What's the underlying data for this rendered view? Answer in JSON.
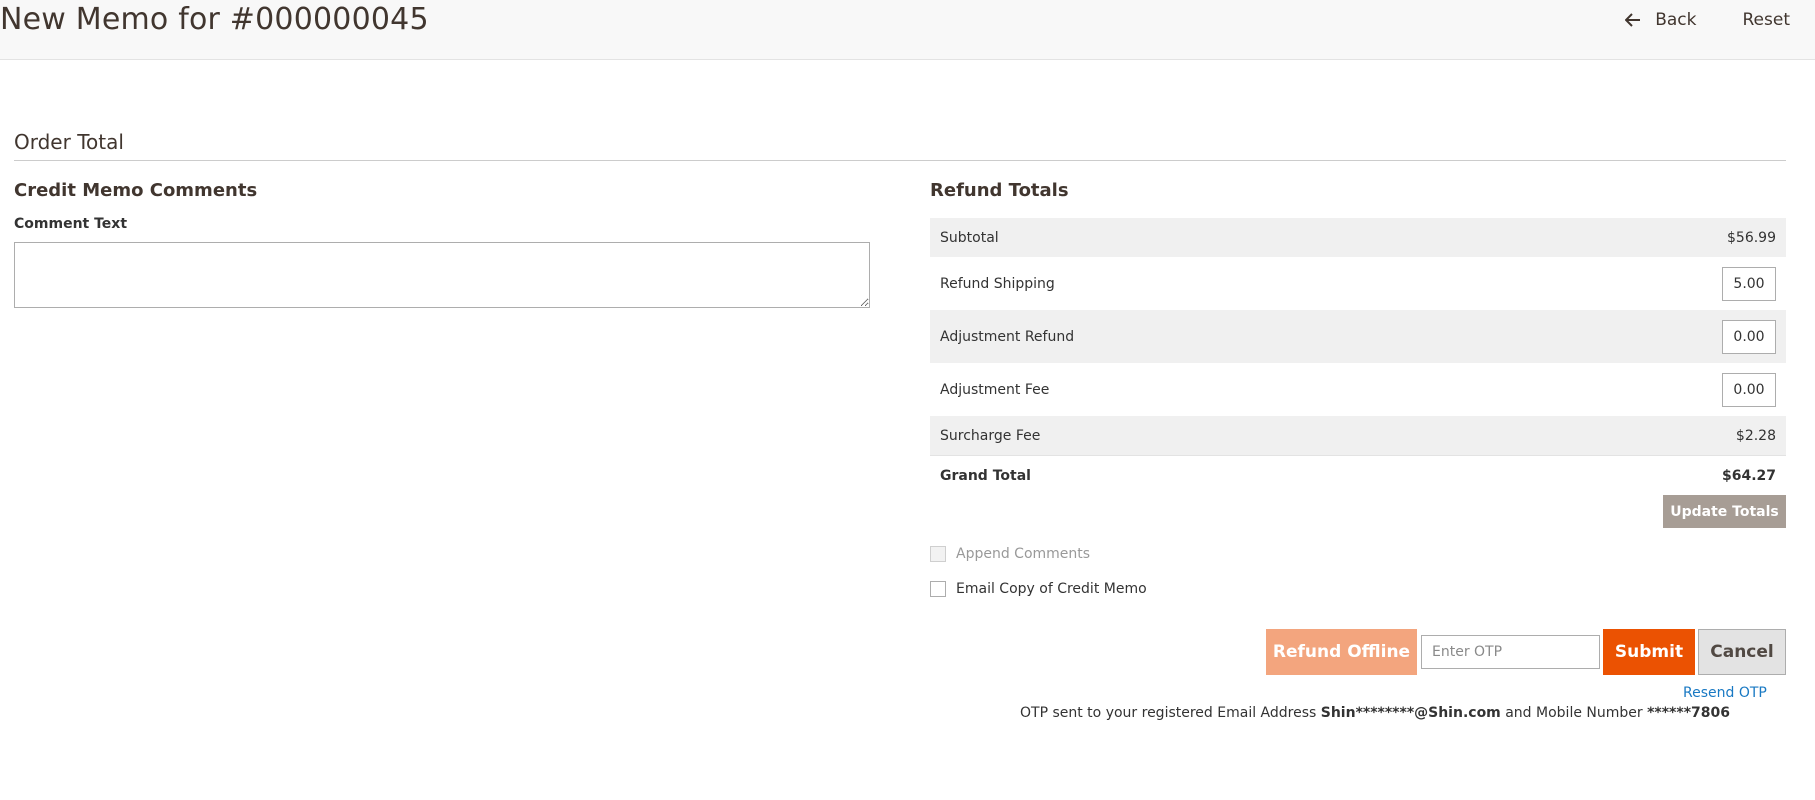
{
  "header": {
    "title": "New Memo for #000000045",
    "back_label": "Back",
    "reset_label": "Reset"
  },
  "order_total": {
    "title": "Order Total"
  },
  "comments": {
    "title": "Credit Memo Comments",
    "comment_label": "Comment Text",
    "comment_value": ""
  },
  "refund_totals": {
    "title": "Refund Totals",
    "subtotal": {
      "label": "Subtotal",
      "value": "$56.99"
    },
    "refund_shipping": {
      "label": "Refund Shipping",
      "value": "5.00"
    },
    "adjustment_refund": {
      "label": "Adjustment Refund",
      "value": "0.00"
    },
    "adjustment_fee": {
      "label": "Adjustment Fee",
      "value": "0.00"
    },
    "surcharge_fee": {
      "label": "Surcharge Fee",
      "value": "$2.28"
    },
    "grand_total": {
      "label": "Grand Total",
      "value": "$64.27"
    },
    "update_label": "Update Totals"
  },
  "options": {
    "append_comments": {
      "label": "Append Comments",
      "checked": false,
      "disabled": true
    },
    "email_copy": {
      "label": "Email Copy of Credit Memo",
      "checked": false
    }
  },
  "actions": {
    "refund_offline_label": "Refund Offline",
    "otp_placeholder": "Enter OTP",
    "otp_value": "",
    "submit_label": "Submit",
    "cancel_label": "Cancel",
    "resend_label": "Resend OTP"
  },
  "otp_notice": {
    "prefix": "OTP sent to your registered Email Address ",
    "email": "Shin********@Shin.com",
    "middle": " and Mobile Number ",
    "mobile": "******7806"
  },
  "colors": {
    "primary": "#eb5202",
    "primary_disabled": "#f3a57e",
    "update_button": "#a79d95",
    "link": "#1979c3",
    "row_shade": "#f0f0f0"
  }
}
